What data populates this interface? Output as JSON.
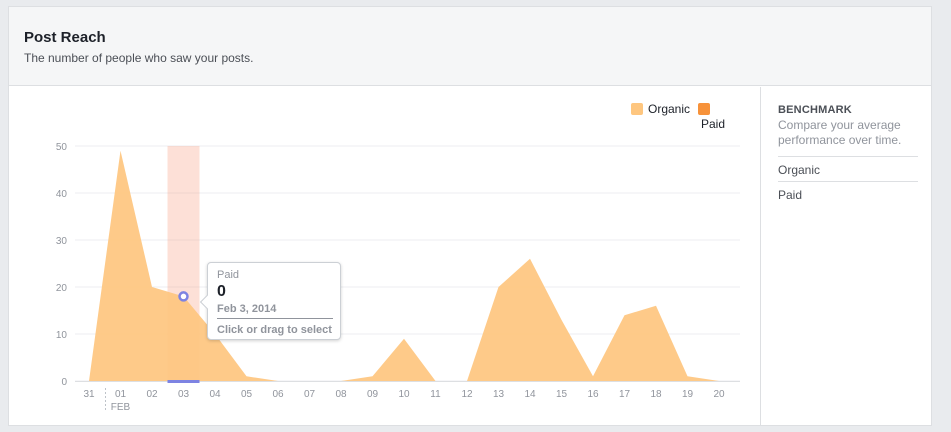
{
  "header": {
    "title": "Post Reach",
    "subtitle": "The number of people who saw your posts."
  },
  "sidebar": {
    "title": "BENCHMARK",
    "description": "Compare your average performance over time.",
    "items": [
      {
        "label": "Organic"
      },
      {
        "label": "Paid"
      }
    ]
  },
  "tooltip": {
    "series": "Paid",
    "value": "0",
    "date": "Feb 3, 2014",
    "hint": "Click or drag to select"
  },
  "colors": {
    "organic": "#fec67f",
    "paid": "#f7923a",
    "highlight": "#f9a78d",
    "marker": "#7d83e2",
    "grid": "#eceef1",
    "axis_text": "#90949c"
  },
  "chart_data": {
    "type": "area",
    "title": "Post Reach",
    "x": [
      "31",
      "01",
      "02",
      "03",
      "04",
      "05",
      "06",
      "07",
      "08",
      "09",
      "10",
      "11",
      "12",
      "13",
      "14",
      "15",
      "16",
      "17",
      "18",
      "19",
      "20"
    ],
    "x_sublabel": {
      "index": 1,
      "text": "FEB"
    },
    "ylim": [
      0,
      50
    ],
    "yticks": [
      "0",
      "10",
      "20",
      "30",
      "40",
      "50"
    ],
    "grid": true,
    "legend_position": "top-right",
    "selected_index": 3,
    "series": [
      {
        "name": "Organic",
        "color": "#fec67f",
        "values": [
          0,
          49,
          20,
          18,
          10,
          1,
          0,
          0,
          0,
          1,
          9,
          0,
          0,
          20,
          26,
          13,
          1,
          14,
          16,
          1,
          0
        ]
      },
      {
        "name": "Paid",
        "color": "#f7923a",
        "values": [
          0,
          0,
          0,
          0,
          0,
          0,
          0,
          0,
          0,
          0,
          0,
          0,
          0,
          0,
          0,
          0,
          0,
          0,
          0,
          0,
          0
        ]
      }
    ]
  }
}
